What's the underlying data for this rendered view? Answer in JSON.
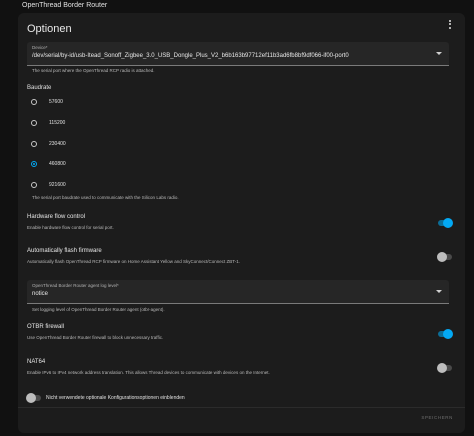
{
  "app": {
    "title": "OpenThread Border Router"
  },
  "card": {
    "title": "Optionen"
  },
  "device": {
    "label": "Device*",
    "value": "/dev/serial/by-id/usb-Itead_Sonoff_Zigbee_3.0_USB_Dongle_Plus_V2_b6b163b97712ef11b3ad6fb8bf9df066-if00-port0",
    "helper": "The serial port where the OpenThread RCP radio is attached."
  },
  "baudrate": {
    "label": "Baudrate",
    "options": [
      "57600",
      "115200",
      "230400",
      "460800",
      "921600"
    ],
    "selected": "460800",
    "helper": "The serial port baudrate used to communicate with the Silicon Labs radio."
  },
  "options": {
    "hardware_flow": {
      "title": "Hardware flow control",
      "desc": "Enable hardware flow control for serial port.",
      "on": true
    },
    "auto_flash": {
      "title": "Automatically flash firmware",
      "desc": "Automatically flash OpenThread RCP firmware on Home Assistant Yellow and SkyConnect/Connect ZBT-1.",
      "on": false
    },
    "otbr_firewall": {
      "title": "OTBR firewall",
      "desc": "Use OpenThread Border Router firewall to block unnecessary traffic.",
      "on": true
    },
    "nat64": {
      "title": "NAT64",
      "desc": "Enable IPv6 to IPv4 network address translation. This allows Thread devices to communicate with devices on the Internet.",
      "on": false
    }
  },
  "log_level": {
    "label": "OpenThread Border Router agent log level*",
    "value": "notice",
    "helper": "Set logging level of OpenThread Border Router agent (otbr-agent)."
  },
  "show_unused": {
    "label": "Nicht verwendete optionale Konfigurationsoptionen einblenden",
    "on": false
  },
  "save": {
    "label": "SPEICHERN"
  },
  "colors": {
    "accent": "#03a9f4",
    "card": "#1c1c1c",
    "background": "#111111"
  }
}
